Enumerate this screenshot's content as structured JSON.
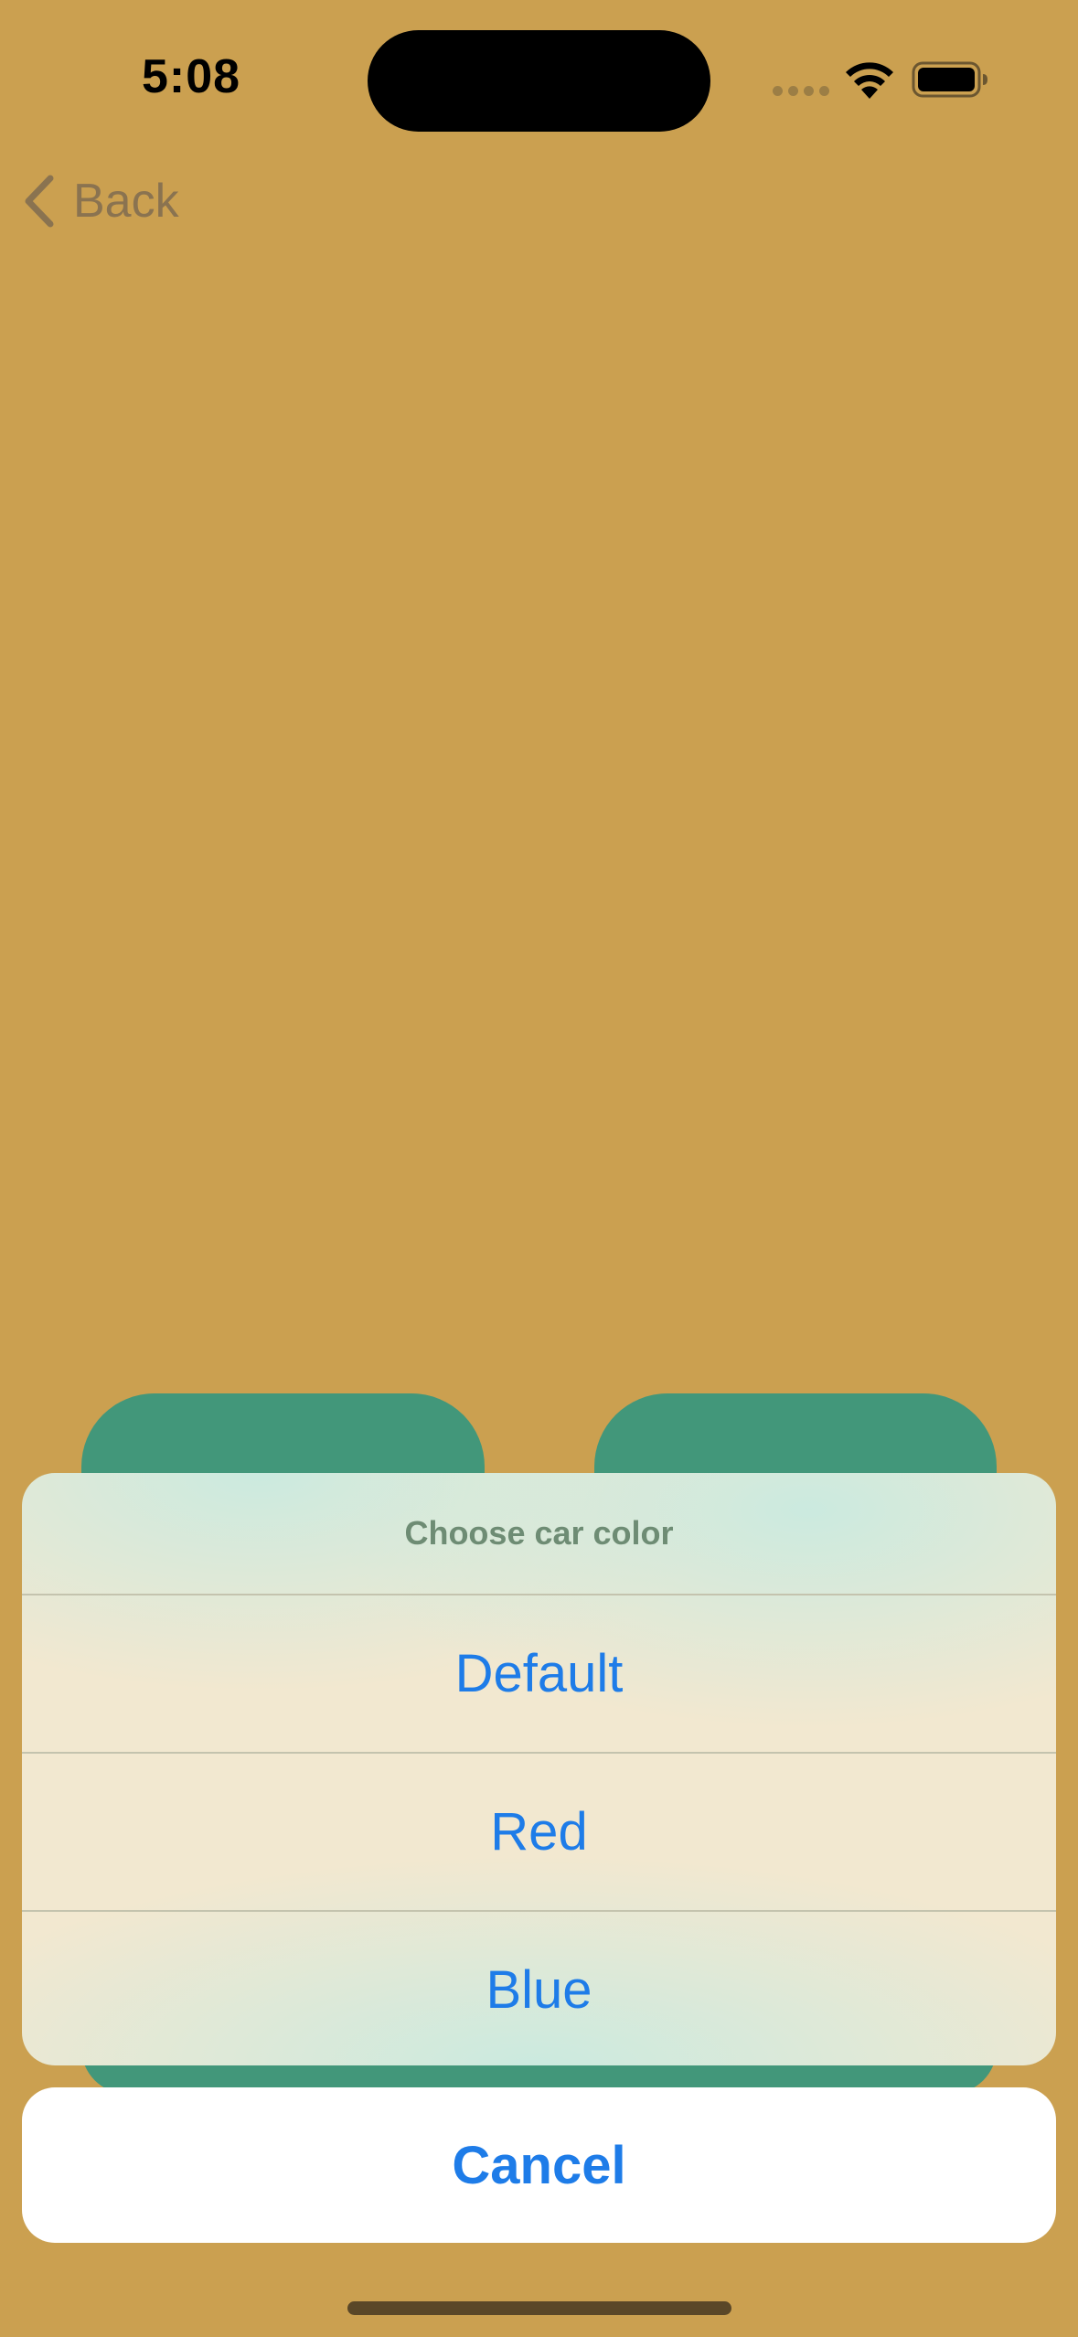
{
  "status_bar": {
    "time": "5:08",
    "signal_icon": "cellular-dots-icon",
    "wifi_icon": "wifi-icon",
    "battery_icon": "battery-icon"
  },
  "nav": {
    "back_label": "Back",
    "back_icon": "chevron-left-icon"
  },
  "action_sheet": {
    "title": "Choose car color",
    "options": [
      "Default",
      "Red",
      "Blue"
    ],
    "cancel_label": "Cancel"
  },
  "colors": {
    "background": "#CBA050",
    "button_green": "#42977A",
    "accent_blue": "#1E7CE8"
  }
}
